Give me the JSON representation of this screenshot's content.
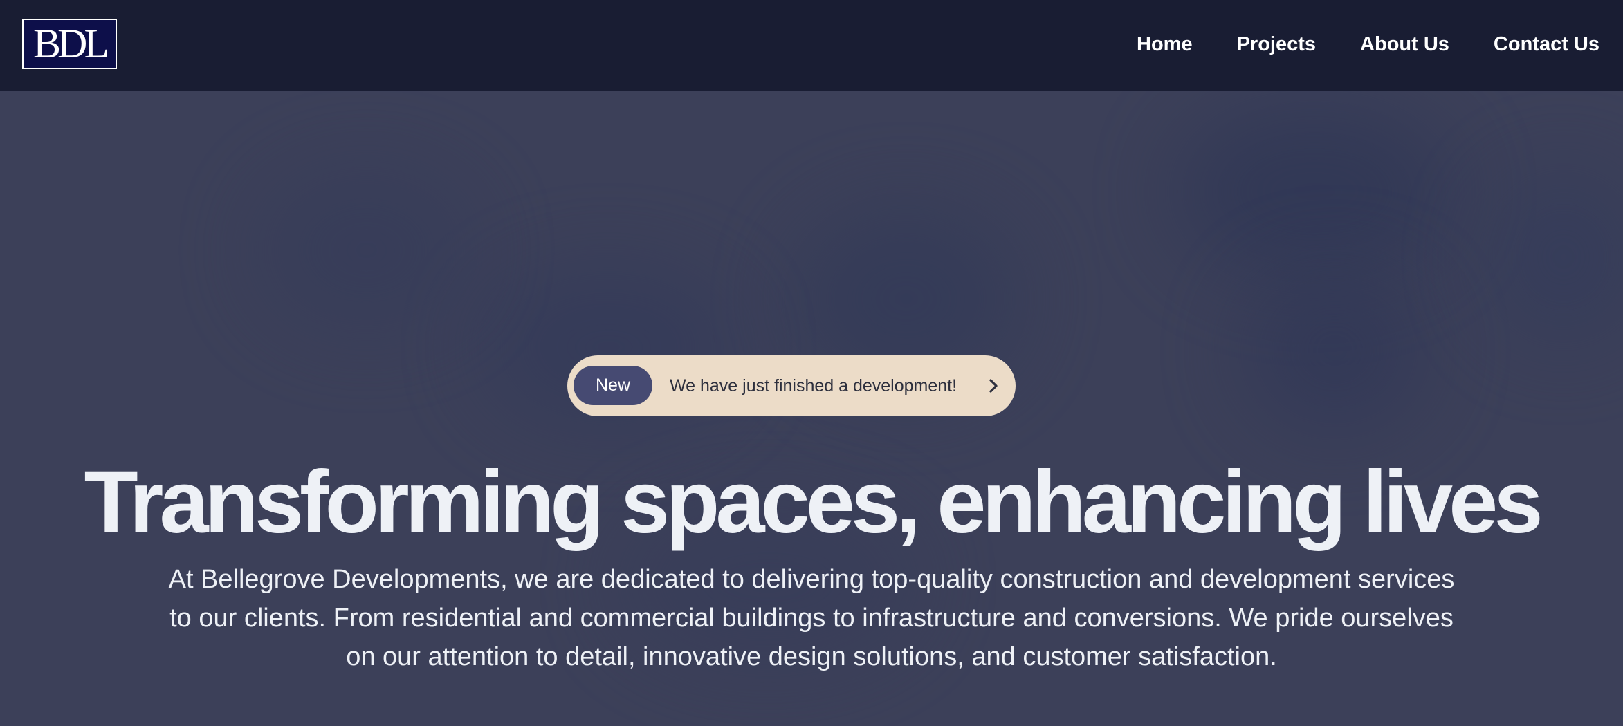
{
  "header": {
    "logo_text": "BDL",
    "nav": [
      {
        "label": "Home"
      },
      {
        "label": "Projects"
      },
      {
        "label": "About Us"
      },
      {
        "label": "Contact Us"
      }
    ]
  },
  "hero": {
    "announcement": {
      "badge": "New",
      "text": "We have just finished a development!",
      "icon": "chevron-right-icon"
    },
    "headline": "Transforming spaces, enhancing lives",
    "description": "At Bellegrove Developments, we are dedicated to delivering top-quality construction and development services to our clients. From residential and commercial buildings to infrastructure and conversions. We pride ourselves on our attention to detail, innovative design solutions, and customer satisfaction."
  },
  "colors": {
    "nav_background": "#191d33",
    "hero_overlay": "#3c4059",
    "badge_background": "#464a72",
    "announcement_background": "#ecdcc8",
    "logo_background": "#0d0f4a"
  }
}
